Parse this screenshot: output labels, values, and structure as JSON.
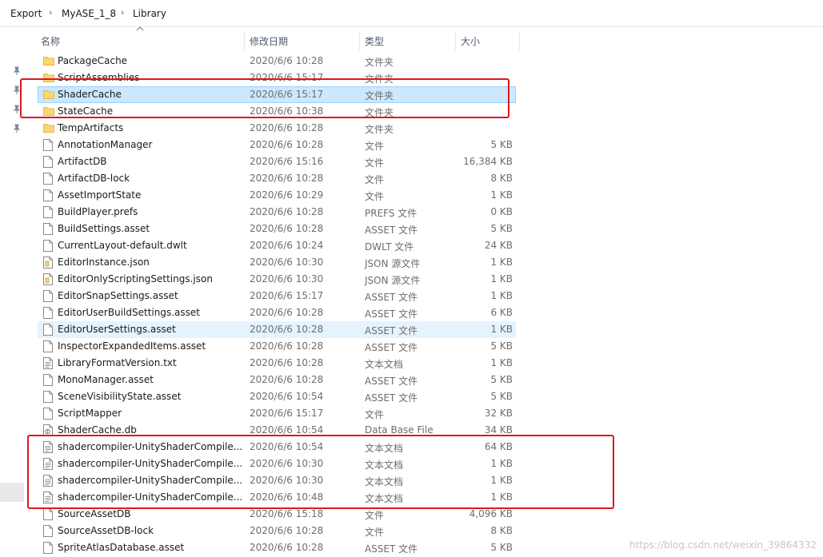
{
  "breadcrumb": {
    "items": [
      "Export",
      "MyASE_1_8",
      "Library"
    ],
    "separator": "›"
  },
  "columns": {
    "name": "名称",
    "date": "修改日期",
    "type": "类型",
    "size": "大小"
  },
  "files": [
    {
      "name": "PackageCache",
      "date": "2020/6/6 10:28",
      "type": "文件夹",
      "size": "",
      "icon": "folder-icon"
    },
    {
      "name": "ScriptAssemblies",
      "date": "2020/6/6 15:17",
      "type": "文件夹",
      "size": "",
      "icon": "folder-icon"
    },
    {
      "name": "ShaderCache",
      "date": "2020/6/6 15:17",
      "type": "文件夹",
      "size": "",
      "icon": "folder-icon",
      "state": "selected"
    },
    {
      "name": "StateCache",
      "date": "2020/6/6 10:38",
      "type": "文件夹",
      "size": "",
      "icon": "folder-icon"
    },
    {
      "name": "TempArtifacts",
      "date": "2020/6/6 10:28",
      "type": "文件夹",
      "size": "",
      "icon": "folder-icon"
    },
    {
      "name": "AnnotationManager",
      "date": "2020/6/6 10:28",
      "type": "文件",
      "size": "5 KB",
      "icon": "file-icon"
    },
    {
      "name": "ArtifactDB",
      "date": "2020/6/6 15:16",
      "type": "文件",
      "size": "16,384 KB",
      "icon": "file-icon"
    },
    {
      "name": "ArtifactDB-lock",
      "date": "2020/6/6 10:28",
      "type": "文件",
      "size": "8 KB",
      "icon": "file-icon"
    },
    {
      "name": "AssetImportState",
      "date": "2020/6/6 10:29",
      "type": "文件",
      "size": "1 KB",
      "icon": "file-icon"
    },
    {
      "name": "BuildPlayer.prefs",
      "date": "2020/6/6 10:28",
      "type": "PREFS 文件",
      "size": "0 KB",
      "icon": "file-icon"
    },
    {
      "name": "BuildSettings.asset",
      "date": "2020/6/6 10:28",
      "type": "ASSET 文件",
      "size": "5 KB",
      "icon": "file-icon"
    },
    {
      "name": "CurrentLayout-default.dwlt",
      "date": "2020/6/6 10:24",
      "type": "DWLT 文件",
      "size": "24 KB",
      "icon": "file-icon"
    },
    {
      "name": "EditorInstance.json",
      "date": "2020/6/6 10:30",
      "type": "JSON 源文件",
      "size": "1 KB",
      "icon": "json-file-icon"
    },
    {
      "name": "EditorOnlyScriptingSettings.json",
      "date": "2020/6/6 10:30",
      "type": "JSON 源文件",
      "size": "1 KB",
      "icon": "json-file-icon"
    },
    {
      "name": "EditorSnapSettings.asset",
      "date": "2020/6/6 15:17",
      "type": "ASSET 文件",
      "size": "1 KB",
      "icon": "file-icon"
    },
    {
      "name": "EditorUserBuildSettings.asset",
      "date": "2020/6/6 10:28",
      "type": "ASSET 文件",
      "size": "6 KB",
      "icon": "file-icon"
    },
    {
      "name": "EditorUserSettings.asset",
      "date": "2020/6/6 10:28",
      "type": "ASSET 文件",
      "size": "1 KB",
      "icon": "file-icon",
      "state": "hover"
    },
    {
      "name": "InspectorExpandedItems.asset",
      "date": "2020/6/6 10:28",
      "type": "ASSET 文件",
      "size": "5 KB",
      "icon": "file-icon"
    },
    {
      "name": "LibraryFormatVersion.txt",
      "date": "2020/6/6 10:28",
      "type": "文本文档",
      "size": "1 KB",
      "icon": "text-file-icon"
    },
    {
      "name": "MonoManager.asset",
      "date": "2020/6/6 10:28",
      "type": "ASSET 文件",
      "size": "5 KB",
      "icon": "file-icon"
    },
    {
      "name": "SceneVisibilityState.asset",
      "date": "2020/6/6 10:54",
      "type": "ASSET 文件",
      "size": "5 KB",
      "icon": "file-icon"
    },
    {
      "name": "ScriptMapper",
      "date": "2020/6/6 15:17",
      "type": "文件",
      "size": "32 KB",
      "icon": "file-icon"
    },
    {
      "name": "ShaderCache.db",
      "date": "2020/6/6 10:54",
      "type": "Data Base File",
      "size": "34 KB",
      "icon": "db-file-icon"
    },
    {
      "name": "shadercompiler-UnityShaderCompile...",
      "date": "2020/6/6 10:54",
      "type": "文本文档",
      "size": "64 KB",
      "icon": "text-file-icon"
    },
    {
      "name": "shadercompiler-UnityShaderCompile...",
      "date": "2020/6/6 10:30",
      "type": "文本文档",
      "size": "1 KB",
      "icon": "text-file-icon"
    },
    {
      "name": "shadercompiler-UnityShaderCompile...",
      "date": "2020/6/6 10:30",
      "type": "文本文档",
      "size": "1 KB",
      "icon": "text-file-icon"
    },
    {
      "name": "shadercompiler-UnityShaderCompile...",
      "date": "2020/6/6 10:48",
      "type": "文本文档",
      "size": "1 KB",
      "icon": "text-file-icon"
    },
    {
      "name": "SourceAssetDB",
      "date": "2020/6/6 15:18",
      "type": "文件",
      "size": "4,096 KB",
      "icon": "file-icon"
    },
    {
      "name": "SourceAssetDB-lock",
      "date": "2020/6/6 10:28",
      "type": "文件",
      "size": "8 KB",
      "icon": "file-icon"
    },
    {
      "name": "SpriteAtlasDatabase.asset",
      "date": "2020/6/6 10:28",
      "type": "ASSET 文件",
      "size": "5 KB",
      "icon": "file-icon"
    }
  ],
  "watermark": "https://blog.csdn.net/weixin_39864332",
  "colors": {
    "folder": "#f8d775",
    "folder_dark": "#e6b84a",
    "selection": "#cce8ff",
    "hover": "#e5f3ff",
    "highlight_box": "#e0171c"
  }
}
